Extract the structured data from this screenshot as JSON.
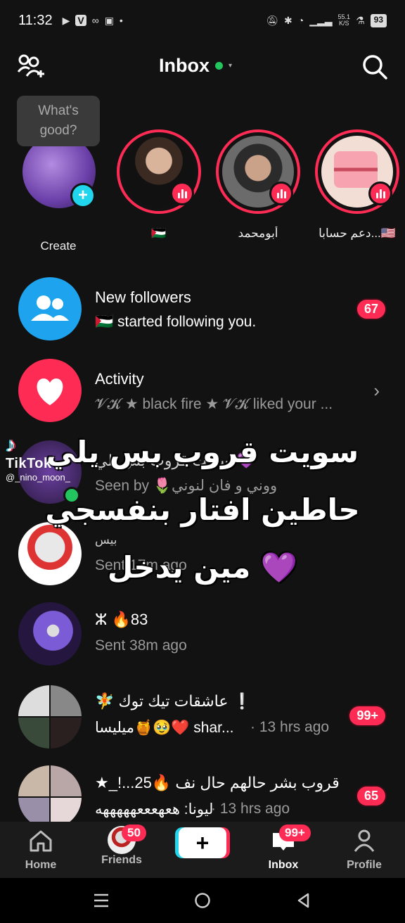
{
  "status_bar": {
    "time": "11:32",
    "network_speed_value": "55.1",
    "network_speed_unit": "K/S",
    "battery": "93"
  },
  "header": {
    "title": "Inbox"
  },
  "stories": {
    "bubble_text_line1": "What's",
    "bubble_text_line2": "good?",
    "items": [
      {
        "label": "Create"
      },
      {
        "label": "🇵🇸"
      },
      {
        "label": "أبومحمد"
      },
      {
        "label": "دعم حسابا...🇺🇸"
      }
    ]
  },
  "rows": {
    "new_followers": {
      "title": "New followers",
      "subtitle": "🇵🇸 started following you.",
      "badge": "67"
    },
    "activity": {
      "title": "Activity",
      "subtitle": "𝓥𝓚 ★ black fire ★ 𝓥𝓚 liked your ..."
    },
    "group_chat": {
      "title": "سويت قروب بس يلي 💜",
      "subtitle": "Seen by 🌷ووني و فان لنوني"
    },
    "chat_bees": {
      "title": "بيس",
      "subtitle": "Sent 17m ago"
    },
    "chat_83": {
      "title": "ⵣ 🔥83",
      "subtitle": "Sent 38m ago"
    },
    "group_tiktok": {
      "title": "🧚 عاشقات تيك توك ❕",
      "subtitle_sender": "ميليسا🍯🥹❤️ shar...",
      "subtitle_time": "· 13 hrs ago",
      "badge": "99+"
    },
    "group_bashar": {
      "title": "★_!...قروب بشر حالهم حال نف 🔥25",
      "subtitle_sender": "ليونا: هعهعععهههههه",
      "subtitle_time": "· 13 hrs ago",
      "badge": "65"
    }
  },
  "overlay": {
    "line1": "سويت قروب بس يلي",
    "line2": "حاطين افتار بنفسجي",
    "line3": "مين يدخل 💜",
    "tiktok_brand": "TikTok",
    "tiktok_user": "@_nino_moon_"
  },
  "bottom_nav": {
    "home": "Home",
    "friends": "Friends",
    "friends_badge": "50",
    "create": "+",
    "inbox": "Inbox",
    "inbox_badge": "99+",
    "profile": "Profile"
  },
  "colors": {
    "accent_red": "#fe2c55",
    "accent_cyan": "#20d5ec",
    "online_green": "#22c55e",
    "background": "#121212"
  }
}
